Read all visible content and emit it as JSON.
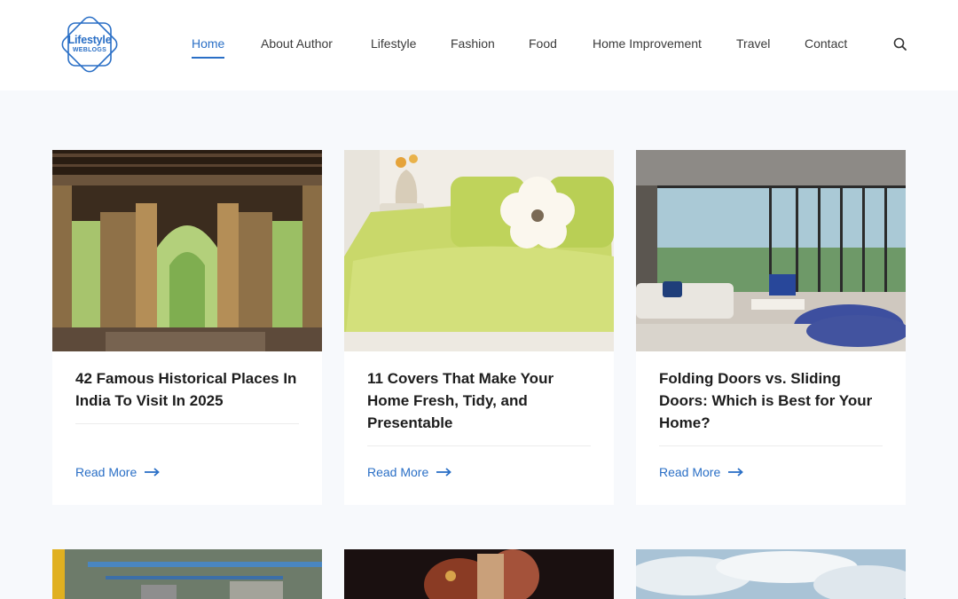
{
  "logo": {
    "line1": "Lifestyle",
    "line2": "WEBLOGS"
  },
  "nav": {
    "items": [
      {
        "label": "Home",
        "active": true
      },
      {
        "label": "About Author"
      },
      {
        "label": "Lifestyle"
      },
      {
        "label": "Fashion"
      },
      {
        "label": "Food"
      },
      {
        "label": "Home Improvement"
      },
      {
        "label": "Travel"
      },
      {
        "label": "Contact"
      }
    ],
    "search_icon": "search-icon"
  },
  "posts": [
    {
      "title": "42 Famous Historical Places In India To Visit In 2025",
      "read_more": "Read More"
    },
    {
      "title": "11 Covers That Make Your Home Fresh, Tidy, and Presentable",
      "read_more": "Read More"
    },
    {
      "title": "Folding Doors vs. Sliding Doors: Which is Best for Your Home?",
      "read_more": "Read More"
    }
  ],
  "colors": {
    "accent": "#2a6fc6",
    "background": "#f7f9fc"
  }
}
